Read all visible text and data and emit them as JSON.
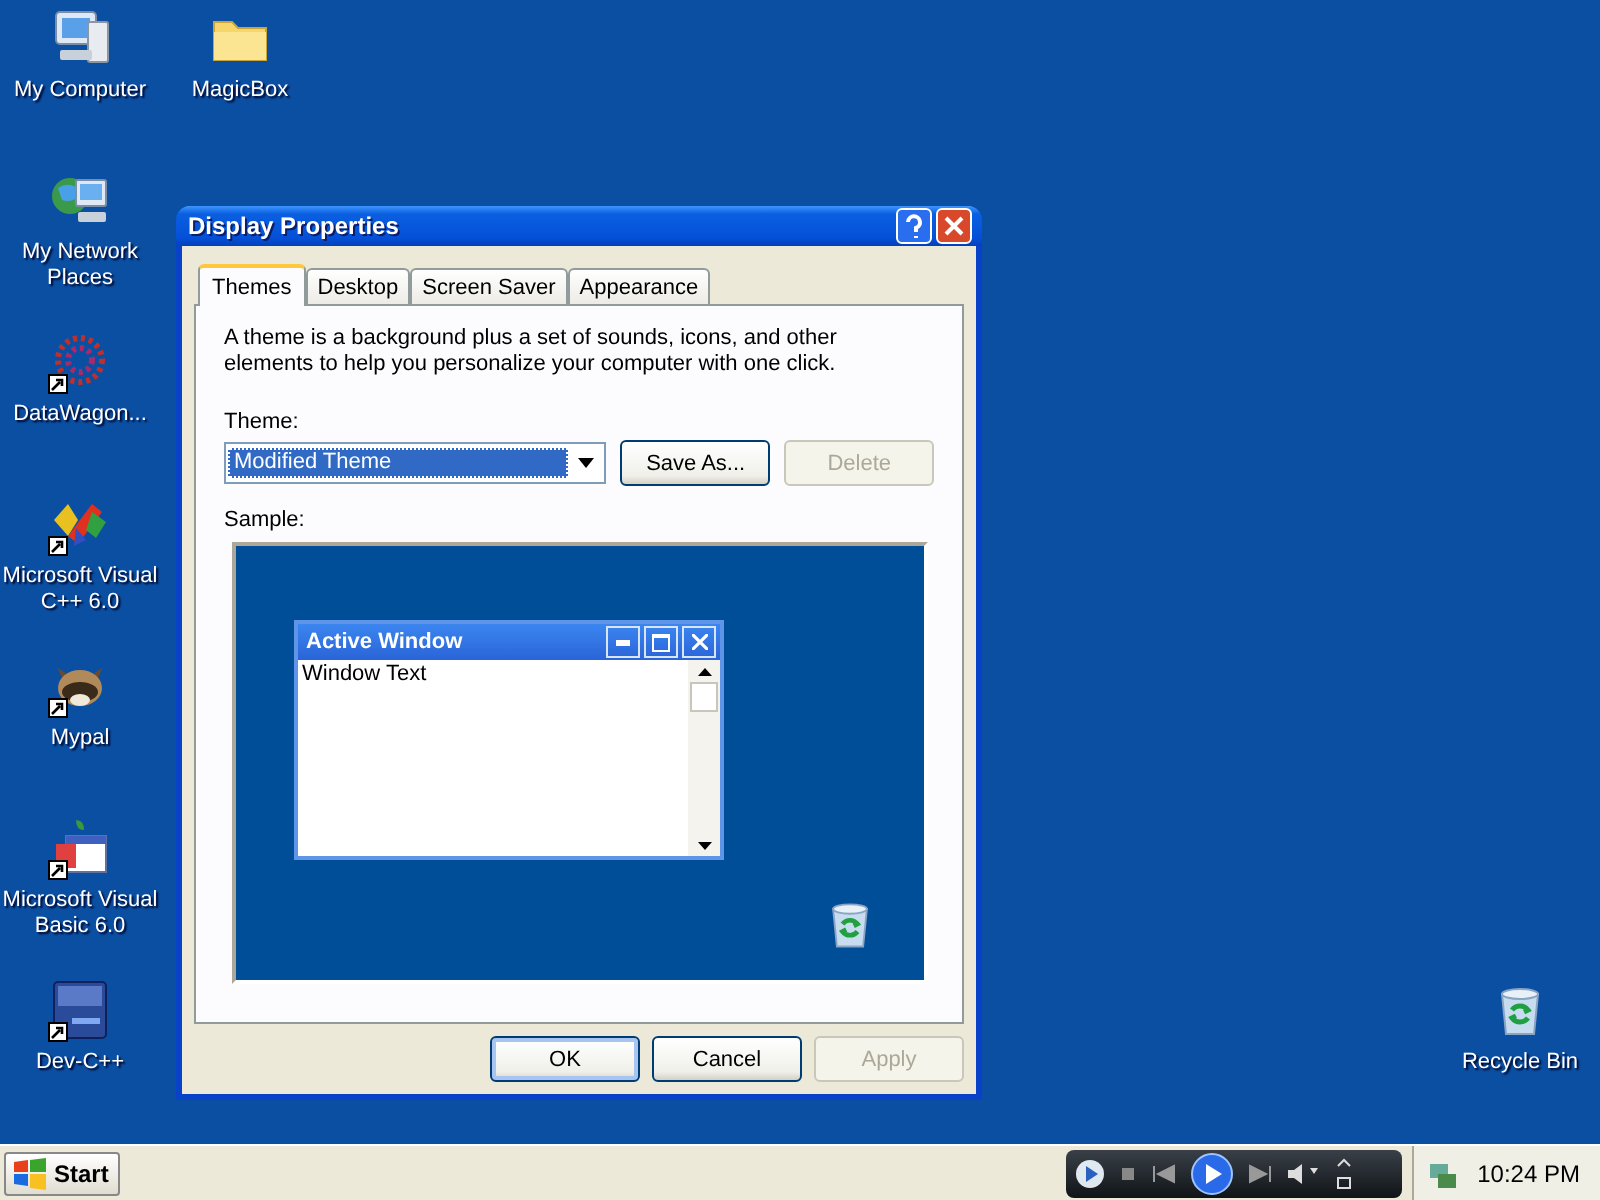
{
  "desktop_icons": [
    {
      "label": "My Computer",
      "kind": "computer",
      "shortcut": false
    },
    {
      "label": "MagicBox",
      "kind": "folder",
      "shortcut": false
    },
    {
      "label": "My Network Places",
      "kind": "network",
      "shortcut": false
    },
    {
      "label": "DataWagon...",
      "kind": "dots",
      "shortcut": true
    },
    {
      "label": "Microsoft Visual C++ 6.0",
      "kind": "shapes",
      "shortcut": true
    },
    {
      "label": "Mypal",
      "kind": "raccoon",
      "shortcut": true
    },
    {
      "label": "Microsoft Visual Basic 6.0",
      "kind": "calendar",
      "shortcut": true
    },
    {
      "label": "Dev-C++",
      "kind": "tile",
      "shortcut": true
    },
    {
      "label": "Recycle Bin",
      "kind": "recycle",
      "shortcut": false
    }
  ],
  "dialog": {
    "title": "Display Properties",
    "tabs": [
      {
        "label": "Themes",
        "selected": true
      },
      {
        "label": "Desktop",
        "selected": false
      },
      {
        "label": "Screen Saver",
        "selected": false
      },
      {
        "label": "Appearance",
        "selected": false
      }
    ],
    "description": "A theme is a background plus a set of sounds, icons, and other elements to help you personalize your computer with one click.",
    "theme_label": "Theme:",
    "theme_field": {
      "value": "Modified Theme",
      "text_selected": true
    },
    "side_buttons": [
      {
        "label": "Save As...",
        "disabled": false
      },
      {
        "label": "Delete",
        "disabled": true
      }
    ],
    "sample_label": "Sample:",
    "sample": {
      "window_title": "Active Window",
      "window_text": "Window Text"
    },
    "buttons": [
      {
        "label": "OK",
        "default": true,
        "disabled": false
      },
      {
        "label": "Cancel",
        "default": false,
        "disabled": false
      },
      {
        "label": "Apply",
        "default": false,
        "disabled": true
      }
    ]
  },
  "taskbar": {
    "start": "Start",
    "clock": "10:24 PM"
  }
}
